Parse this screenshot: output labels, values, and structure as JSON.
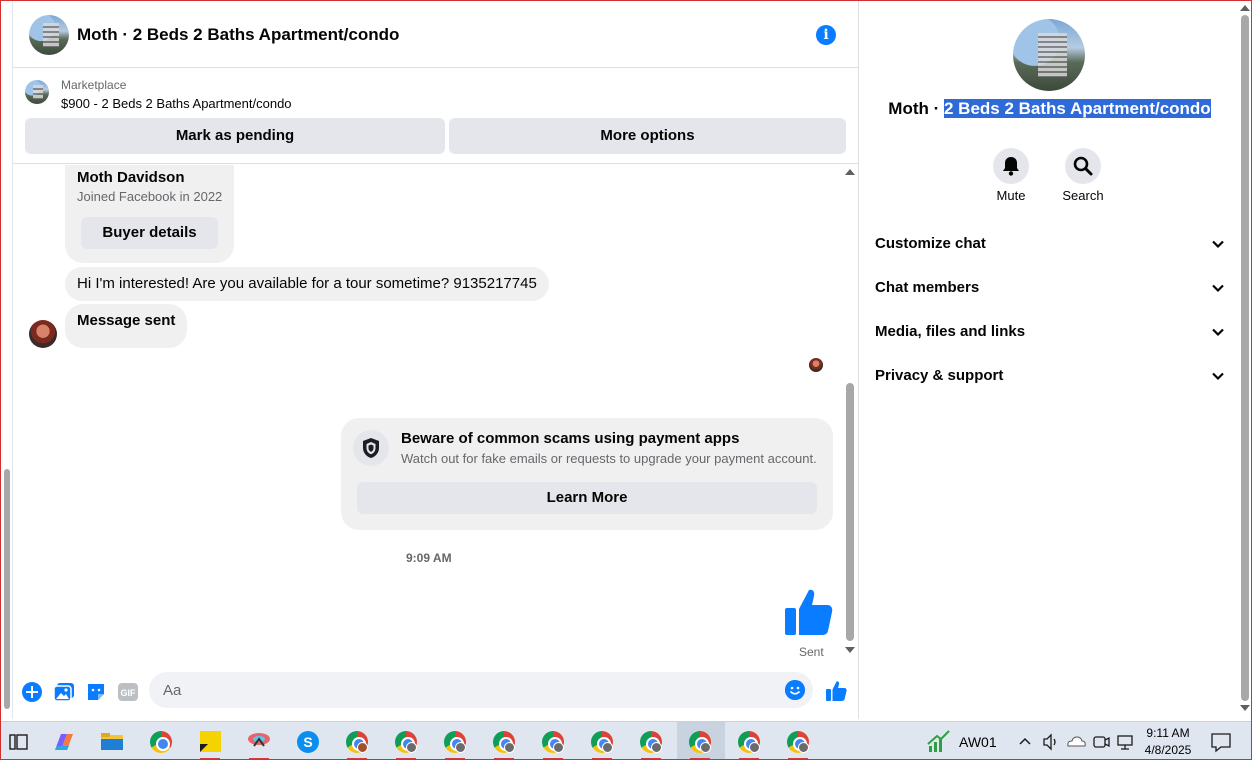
{
  "header": {
    "title": "Moth · 2 Beds 2 Baths Apartment/condo",
    "info_icon": "info-icon"
  },
  "listing": {
    "source": "Marketplace",
    "price_line": "$900 - 2 Beds 2 Baths Apartment/condo",
    "mark_pending_label": "Mark as pending",
    "more_options_label": "More options"
  },
  "messages": {
    "profile_name": "Moth Davidson",
    "profile_joined": "Joined Facebook in 2022",
    "buyer_details_label": "Buyer details",
    "interest_text": "Hi I'm interested! Are you available for a tour sometime? 9135217745",
    "sent_text": "Message sent",
    "scam_title": "Beware of common scams using payment apps",
    "scam_body": "Watch out for fake emails or requests to upgrade your payment account.",
    "learn_more_label": "Learn More",
    "timestamp": "9:09 AM",
    "like_status": "Sent"
  },
  "composer": {
    "placeholder": "Aa",
    "gif_label": "GIF"
  },
  "details": {
    "title_prefix": "Moth · ",
    "title_selected": "2 Beds 2 Baths Apartment/condo",
    "mute_label": "Mute",
    "search_label": "Search",
    "menu": [
      {
        "label": "Customize chat"
      },
      {
        "label": "Chat members"
      },
      {
        "label": "Media, files and links"
      },
      {
        "label": "Privacy & support"
      }
    ]
  },
  "taskbar": {
    "tray_label": "AW01",
    "time": "9:11 AM",
    "date": "4/8/2025"
  },
  "colors": {
    "accent": "#0a7cff",
    "bubble": "#f0f0f0",
    "button": "#e4e6eb",
    "selection": "#2f6ad9",
    "secondary_text": "#65676b"
  }
}
